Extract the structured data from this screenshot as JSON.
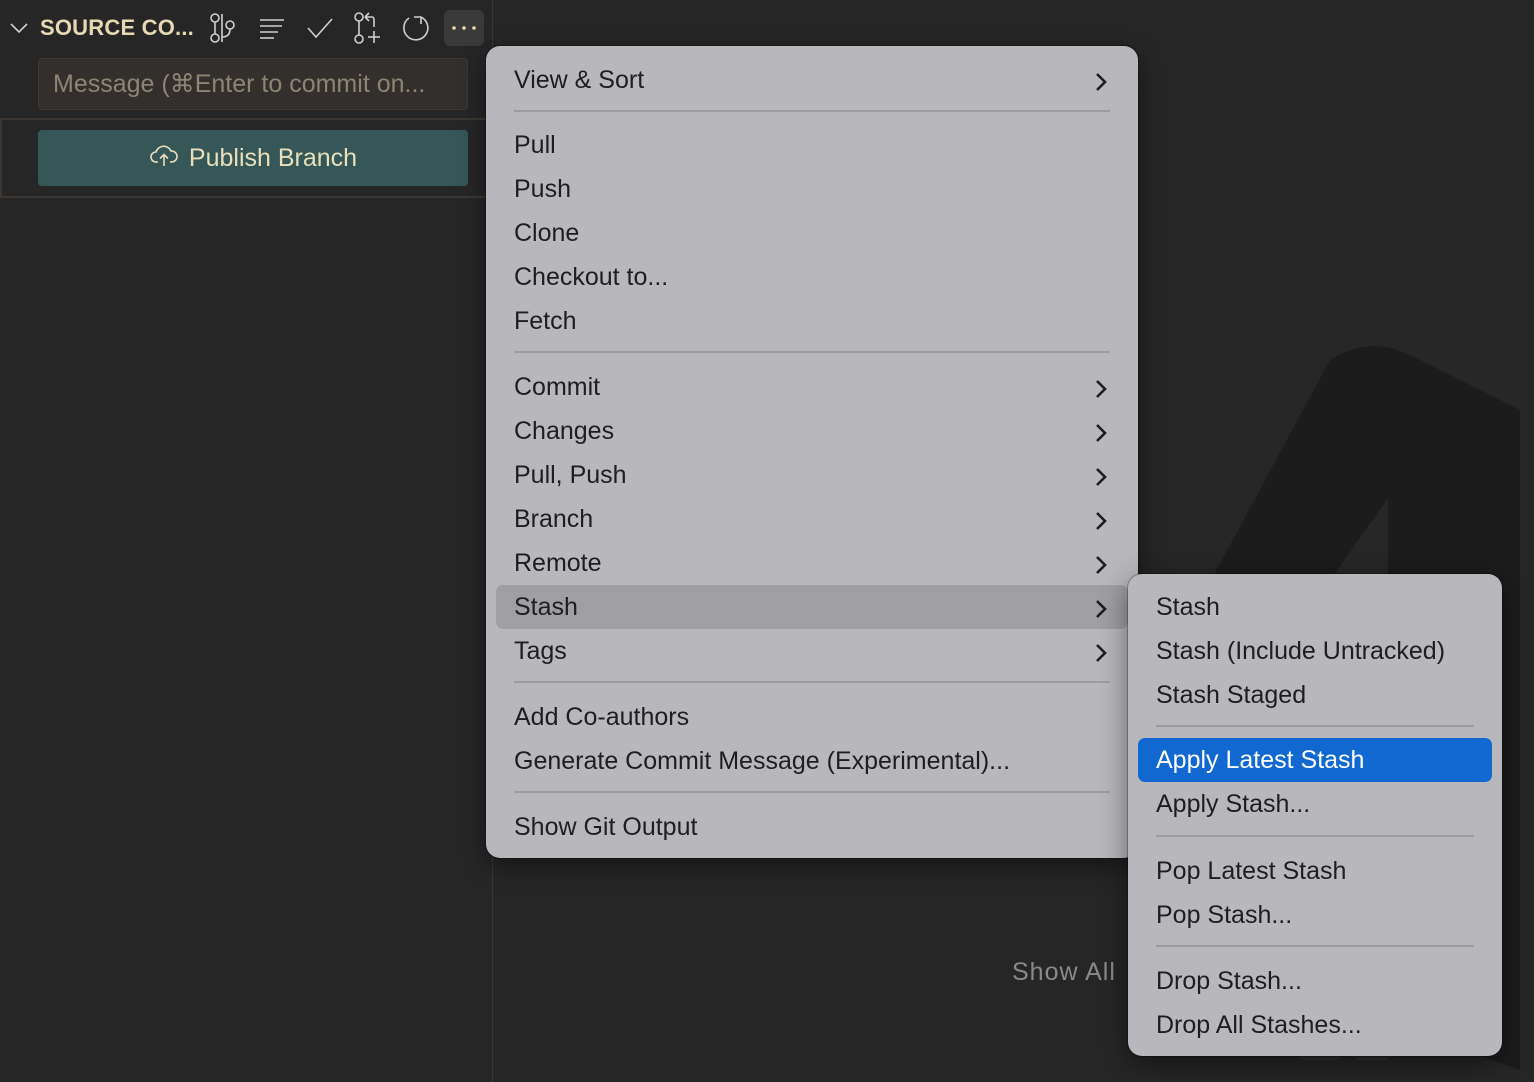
{
  "sidebar": {
    "title": "SOURCE CO...",
    "toolbar": [
      {
        "name": "view-as-tree-icon",
        "label": "View Graph"
      },
      {
        "name": "list-icon",
        "label": "View as List"
      },
      {
        "name": "check-icon",
        "label": "Commit"
      },
      {
        "name": "pull-request-create-icon",
        "label": "Create Pull Request"
      },
      {
        "name": "refresh-icon",
        "label": "Refresh"
      },
      {
        "name": "more-actions-icon",
        "label": "More Actions..."
      }
    ],
    "commit_input": {
      "placeholder": "Message (⌘Enter to commit on...",
      "value": ""
    },
    "publish_button": {
      "label": "Publish Branch",
      "icon": "cloud-upload-icon"
    }
  },
  "background": {
    "show_all_label": "Show All"
  },
  "main_menu": {
    "groups": [
      [
        {
          "label": "View & Sort",
          "submenu": true
        }
      ],
      [
        {
          "label": "Pull",
          "submenu": false
        },
        {
          "label": "Push",
          "submenu": false
        },
        {
          "label": "Clone",
          "submenu": false
        },
        {
          "label": "Checkout to...",
          "submenu": false
        },
        {
          "label": "Fetch",
          "submenu": false
        }
      ],
      [
        {
          "label": "Commit",
          "submenu": true
        },
        {
          "label": "Changes",
          "submenu": true
        },
        {
          "label": "Pull, Push",
          "submenu": true
        },
        {
          "label": "Branch",
          "submenu": true
        },
        {
          "label": "Remote",
          "submenu": true
        },
        {
          "label": "Stash",
          "submenu": true,
          "state": "hover"
        },
        {
          "label": "Tags",
          "submenu": true
        }
      ],
      [
        {
          "label": "Add Co-authors",
          "submenu": false
        },
        {
          "label": "Generate Commit Message (Experimental)...",
          "submenu": false
        }
      ],
      [
        {
          "label": "Show Git Output",
          "submenu": false
        }
      ]
    ]
  },
  "stash_submenu": {
    "groups": [
      [
        {
          "label": "Stash"
        },
        {
          "label": "Stash (Include Untracked)"
        },
        {
          "label": "Stash Staged"
        }
      ],
      [
        {
          "label": "Apply Latest Stash",
          "state": "selected"
        },
        {
          "label": "Apply Stash..."
        }
      ],
      [
        {
          "label": "Pop Latest Stash"
        },
        {
          "label": "Pop Stash..."
        }
      ],
      [
        {
          "label": "Drop Stash..."
        },
        {
          "label": "Drop All Stashes..."
        }
      ]
    ]
  },
  "colors": {
    "accent_selected": "#1268d1",
    "publish_button_bg": "#365757",
    "title_text": "#e6d8b4",
    "menu_bg": "#b8b7bc"
  }
}
